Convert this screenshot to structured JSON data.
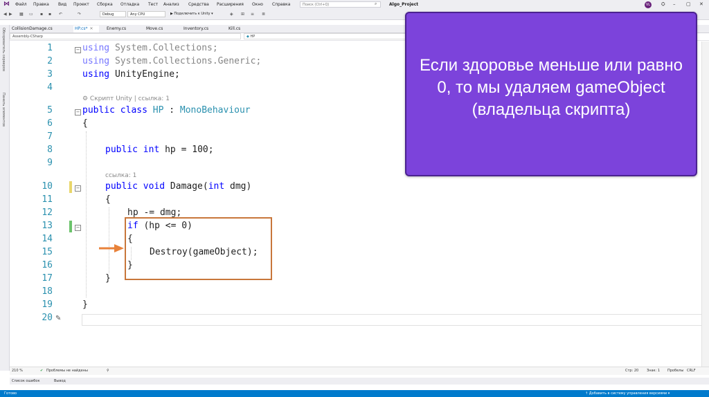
{
  "menubar": {
    "items": [
      "Файл",
      "Правка",
      "Вид",
      "Проект",
      "Сборка",
      "Отладка",
      "Тест",
      "Анализ",
      "Средства",
      "Расширения",
      "Окно",
      "Справка"
    ],
    "search_placeholder": "Поиск (Ctrl+Q)",
    "project_title": "Algo_Project",
    "avatar_initials": "VL"
  },
  "toolbar": {
    "config": "Debug",
    "platform": "Any CPU",
    "attach_label": "▶ Подключить к Unity ▾"
  },
  "tabs": [
    {
      "label": "CollisionDamage.cs"
    },
    {
      "label": "HP.cs*",
      "active": true
    },
    {
      "label": "Enemy.cs"
    },
    {
      "label": "Move.cs"
    },
    {
      "label": "Inventory.cs"
    },
    {
      "label": "Kill.cs"
    }
  ],
  "nav": {
    "project": "Assembly-CSharp",
    "class": "HP"
  },
  "sidebar": {
    "items": [
      "Обозреватель серверов",
      "Панель элементов"
    ]
  },
  "editor": {
    "line_numbers": [
      "1",
      "2",
      "3",
      "4",
      "5",
      "6",
      "7",
      "8",
      "9",
      "10",
      "11",
      "12",
      "13",
      "14",
      "15",
      "16",
      "17",
      "18",
      "19",
      "20"
    ],
    "hint_script": "⚙ Скрипт Unity | ссылка: 1",
    "hint_ref": "ссылка: 1",
    "lines": {
      "l1a": "using",
      "l1b": " System.Collections;",
      "l2a": "using",
      "l2b": " System.Collections.Generic;",
      "l3a": "using",
      "l3b": " UnityEngine;",
      "l5a": "public class",
      "l5b": " HP",
      "l5c": " : ",
      "l5d": "MonoBehaviour",
      "l6": "{",
      "l8a": "public int",
      "l8b": " hp = 100;",
      "l10a": "public void",
      "l10b": " Damage(",
      "l10c": "int",
      "l10d": " dmg)",
      "l11": "{",
      "l12": "hp -= dmg;",
      "l13a": "if",
      "l13b": " (hp <= 0)",
      "l14": "{",
      "l15": "Destroy(gameObject);",
      "l16": "}",
      "l17": "}",
      "l19": "}"
    }
  },
  "status": {
    "zoom": "210 %",
    "problems": "Проблемы не найдены",
    "line": "Стр: 20",
    "col": "Знак: 1",
    "spaces": "Пробелы",
    "eol": "CRLF"
  },
  "bottom_tabs": [
    "Список ошибок",
    "Вывод"
  ],
  "vs_status": {
    "left": "Готово",
    "right": "↑ Добавить в систему управления версиями ▾"
  },
  "panel": {
    "text": "Если здоровье меньше или равно 0, то мы удаляем gameObject (владельца скрипта)"
  },
  "colors": {
    "panel_bg": "#7c43db",
    "highlight": "#c8763a",
    "keyword": "#0000ff",
    "type": "#2b91af"
  }
}
